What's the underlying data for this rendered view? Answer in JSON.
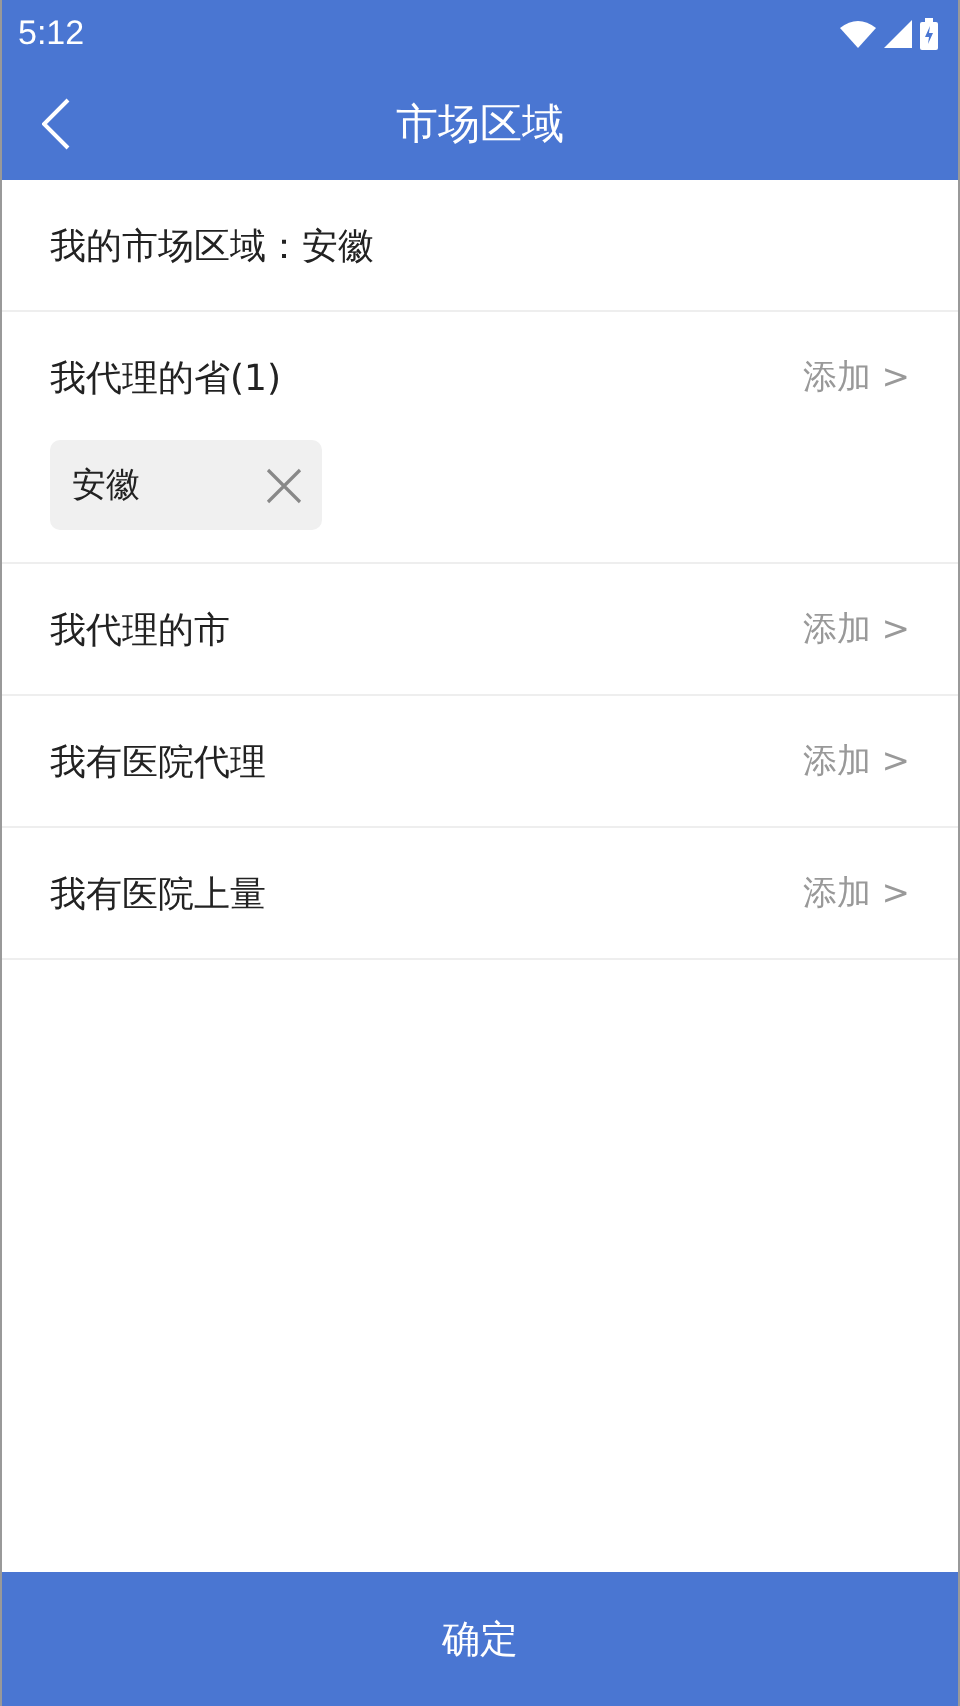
{
  "status_bar": {
    "time": "5:12"
  },
  "header": {
    "title": "市场区域"
  },
  "region": {
    "label": "我的市场区域：安徽"
  },
  "sections": [
    {
      "label": "我代理的省(1)",
      "action": "添加 >",
      "tags": [
        {
          "label": "安徽"
        }
      ]
    },
    {
      "label": "我代理的市",
      "action": "添加 >"
    },
    {
      "label": "我有医院代理",
      "action": "添加 >"
    },
    {
      "label": "我有医院上量",
      "action": "添加 >"
    }
  ],
  "confirm_button": "确定"
}
